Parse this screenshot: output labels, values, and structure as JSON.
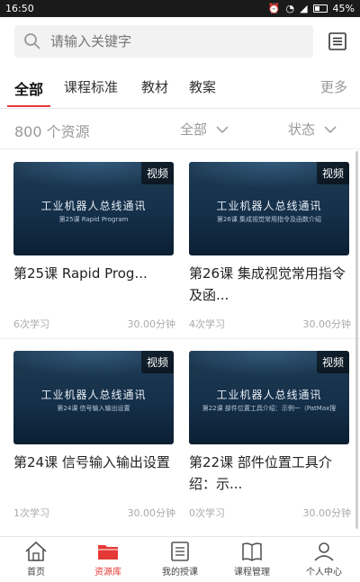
{
  "status_bar": {
    "time": "16:50",
    "battery": "45%"
  },
  "search": {
    "placeholder": "请输入关键字"
  },
  "tabs": [
    {
      "label": "全部",
      "active": true
    },
    {
      "label": "课程标准"
    },
    {
      "label": "教材"
    },
    {
      "label": "教案"
    }
  ],
  "more_label": "更多",
  "filters": {
    "count": "800 个资源",
    "scope": "全部",
    "state": "状态"
  },
  "cards": [
    {
      "badge": "视频",
      "thumb_title": "工业机器人总线通讯",
      "thumb_sub": "第25课 Rapid Program",
      "title": "第25课 Rapid Prog...",
      "studies": "6次学习",
      "duration": "30.00分钟"
    },
    {
      "badge": "视频",
      "thumb_title": "工业机器人总线通讯",
      "thumb_sub": "第26课 集成视觉常用指令及函数介绍",
      "title": "第26课 集成视觉常用指令及函...",
      "studies": "4次学习",
      "duration": "30.00分钟"
    },
    {
      "badge": "视频",
      "thumb_title": "工业机器人总线通讯",
      "thumb_sub": "第24课 信号输入输出设置",
      "title": "第24课 信号输入输出设置",
      "studies": "1次学习",
      "duration": "30.00分钟"
    },
    {
      "badge": "视频",
      "thumb_title": "工业机器人总线通讯",
      "thumb_sub": "第22课 部件位置工具介绍：示例一（PatMax搜",
      "title": "第22课 部件位置工具介绍：示...",
      "studies": "0次学习",
      "duration": "30.00分钟"
    }
  ],
  "bottom_nav": [
    {
      "label": "首页",
      "icon": "home-icon"
    },
    {
      "label": "资源库",
      "icon": "folder-icon",
      "active": true
    },
    {
      "label": "我的授课",
      "icon": "list-icon"
    },
    {
      "label": "课程管理",
      "icon": "book-icon"
    },
    {
      "label": "个人中心",
      "icon": "user-icon"
    }
  ],
  "colors": {
    "accent": "#e53935"
  }
}
